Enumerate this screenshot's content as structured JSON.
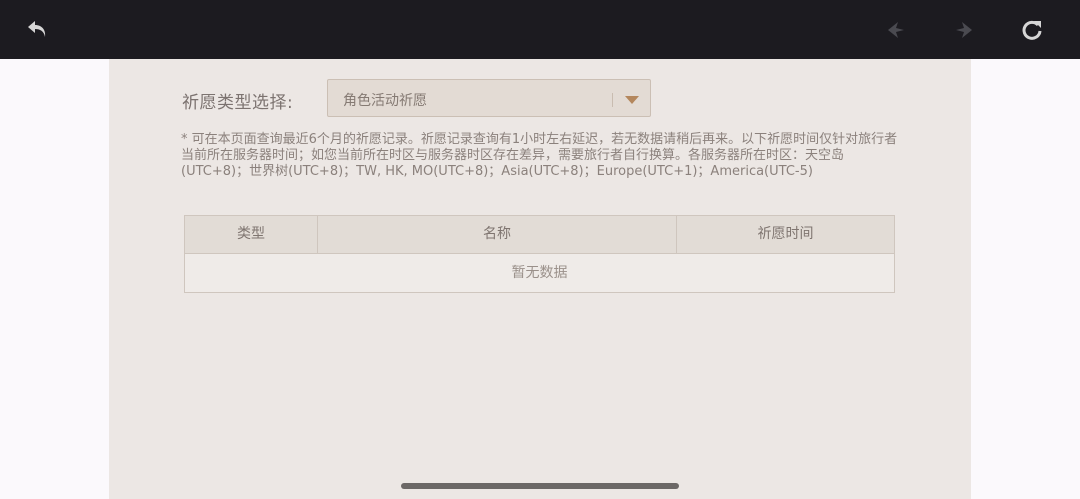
{
  "browser": {
    "back_icon": "undo-arrow-icon",
    "prev_icon": "previous-arrow-icon",
    "next_icon": "next-arrow-icon",
    "refresh_icon": "refresh-icon"
  },
  "filter": {
    "label": "祈愿类型选择:",
    "selected": "角色活动祈愿"
  },
  "notice": "* 可在本页面查询最近6个月的祈愿记录。祈愿记录查询有1小时左右延迟，若无数据请稍后再来。以下祈愿时间仅针对旅行者当前所在服务器时间；如您当前所在时区与服务器时区存在差异，需要旅行者自行换算。各服务器所在时区：天空岛(UTC+8)；世界树(UTC+8)；TW, HK, MO(UTC+8)；Asia(UTC+8)；Europe(UTC+1)；America(UTC-5)",
  "table": {
    "columns": [
      "类型",
      "名称",
      "祈愿时间"
    ],
    "empty_text": "暂无数据"
  },
  "colors": {
    "topbar": "#1c1b20",
    "panel": "#ece7e4",
    "accent": "#b4875d"
  }
}
